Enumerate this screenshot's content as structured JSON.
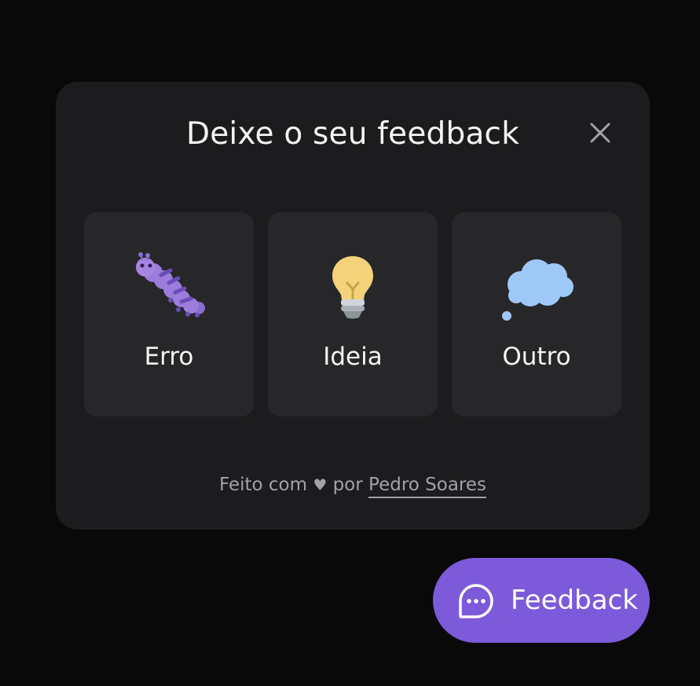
{
  "widget": {
    "title": "Deixe o seu feedback",
    "close_icon": "close-icon",
    "options": [
      {
        "label": "Erro",
        "icon": "bug-icon"
      },
      {
        "label": "Ideia",
        "icon": "lightbulb-icon"
      },
      {
        "label": "Outro",
        "icon": "thought-bubble-icon"
      }
    ],
    "footer": {
      "prefix": "Feito com",
      "heart": "♥",
      "middle": "por",
      "author": "Pedro Soares"
    }
  },
  "fab": {
    "label": "Feedback",
    "icon": "chat-icon"
  },
  "colors": {
    "background": "#09090a",
    "card": "#1c1c1e",
    "option": "#27272a",
    "accent": "#7c5ad9"
  }
}
